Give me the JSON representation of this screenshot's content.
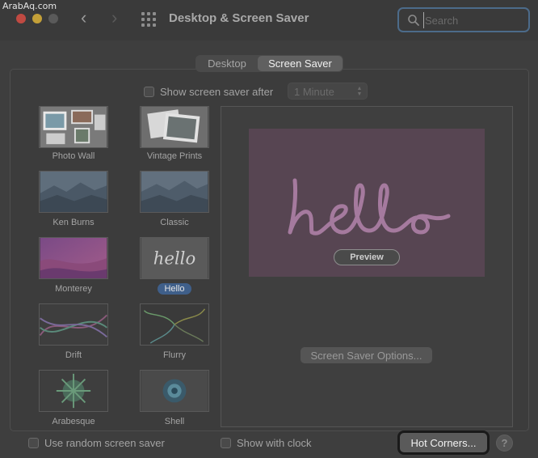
{
  "watermark": "ArabAq.com",
  "window": {
    "title": "Desktop & Screen Saver",
    "search_placeholder": "Search"
  },
  "tabs": [
    {
      "label": "Desktop",
      "selected": false
    },
    {
      "label": "Screen Saver",
      "selected": true
    }
  ],
  "show_after": {
    "label": "Show screen saver after",
    "checked": false,
    "interval": "1 Minute"
  },
  "savers": [
    {
      "name": "Photo Wall",
      "icon": "photo-wall-thumbnail",
      "selected": false
    },
    {
      "name": "Vintage Prints",
      "icon": "vintage-prints-thumbnail",
      "selected": false
    },
    {
      "name": "Ken Burns",
      "icon": "ken-burns-thumbnail",
      "selected": false
    },
    {
      "name": "Classic",
      "icon": "classic-thumbnail",
      "selected": false
    },
    {
      "name": "Monterey",
      "icon": "monterey-thumbnail",
      "selected": false
    },
    {
      "name": "Hello",
      "icon": "hello-thumbnail",
      "selected": true
    },
    {
      "name": "Drift",
      "icon": "drift-thumbnail",
      "selected": false
    },
    {
      "name": "Flurry",
      "icon": "flurry-thumbnail",
      "selected": false
    },
    {
      "name": "Arabesque",
      "icon": "arabesque-thumbnail",
      "selected": false
    },
    {
      "name": "Shell",
      "icon": "shell-thumbnail",
      "selected": false
    }
  ],
  "preview": {
    "button_label": "Preview",
    "options_label": "Screen Saver Options...",
    "screen_color": "#574552"
  },
  "bottom": {
    "random_label": "Use random screen saver",
    "random_checked": false,
    "clock_label": "Show with clock",
    "clock_checked": false,
    "hot_corners_label": "Hot Corners...",
    "help_label": "?"
  },
  "colors": {
    "accent": "#3f5f8a",
    "background": "#3e3e3e",
    "traffic_close": "#c04a42",
    "traffic_minimize": "#c4a038"
  }
}
